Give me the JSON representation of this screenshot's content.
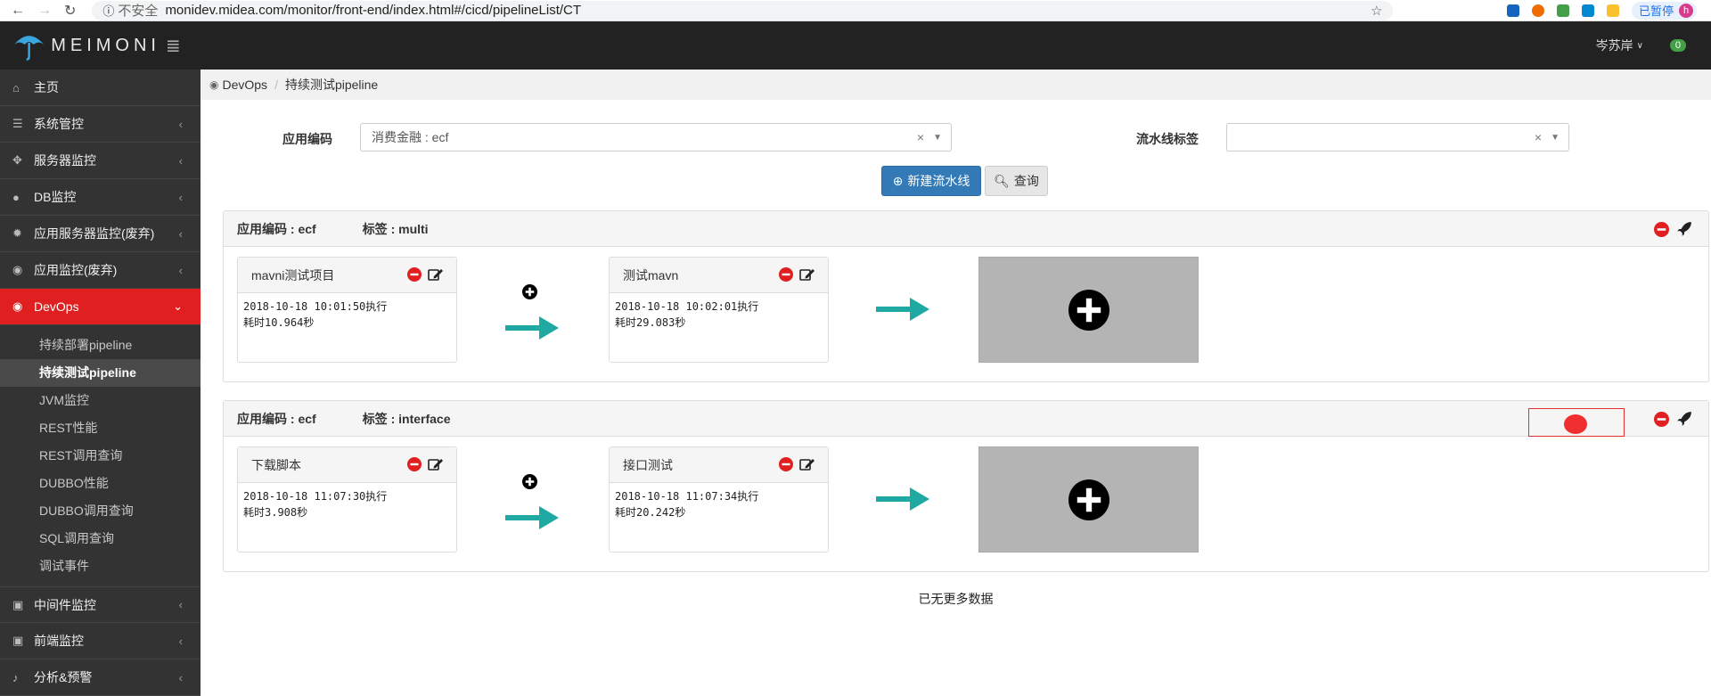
{
  "browser": {
    "security": "不安全",
    "url": "monidev.midea.com/monitor/front-end/index.html#/cicd/pipelineList/CT",
    "profile_label": "已暂停",
    "profile_initial": "h"
  },
  "header": {
    "logo_text": "MEIMONI",
    "user_name": "岑苏岸",
    "message_count": "0"
  },
  "sidebar": {
    "items": [
      {
        "label": "主页",
        "icon": "home-icon"
      },
      {
        "label": "系统管控",
        "icon": "server-stack-icon"
      },
      {
        "label": "服务器监控",
        "icon": "crosshair-icon"
      },
      {
        "label": "DB监控",
        "icon": "globe-icon"
      },
      {
        "label": "应用服务器监控(废弃)",
        "icon": "gear-icon"
      },
      {
        "label": "应用监控(废弃)",
        "icon": "eye-icon"
      },
      {
        "label": "DevOps",
        "icon": "eye-icon"
      }
    ],
    "devops_sub": [
      "持续部署pipeline",
      "持续测试pipeline",
      "JVM监控",
      "REST性能",
      "REST调用查询",
      "DUBBO性能",
      "DUBBO调用查询",
      "SQL调用查询",
      "调试事件"
    ],
    "bottom_items": [
      {
        "label": "中间件监控",
        "icon": "briefcase-icon"
      },
      {
        "label": "前端监控",
        "icon": "briefcase-icon"
      },
      {
        "label": "分析&预警",
        "icon": "bell-icon"
      }
    ]
  },
  "breadcrumb": {
    "root": "DevOps",
    "current": "持续测试pipeline"
  },
  "filter": {
    "app_code_label": "应用编码",
    "app_code_value": "消费金融 : ecf",
    "tag_label": "流水线标签",
    "tag_value": "",
    "new_button": "新建流水线",
    "query_button": "查询"
  },
  "pipelines": [
    {
      "app_code": "应用编码 : ecf",
      "tag": "标签 : multi",
      "stages": [
        {
          "name": "mavni测试项目",
          "time": "2018-10-18 10:01:50执行",
          "duration": "耗时10.964秒"
        },
        {
          "name": "测试mavn",
          "time": "2018-10-18 10:02:01执行",
          "duration": "耗时29.083秒"
        }
      ]
    },
    {
      "app_code": "应用编码 : ecf",
      "tag": "标签 : interface",
      "stages": [
        {
          "name": "下载脚本",
          "time": "2018-10-18 11:07:30执行",
          "duration": "耗时3.908秒"
        },
        {
          "name": "接口测试",
          "time": "2018-10-18 11:07:34执行",
          "duration": "耗时20.242秒"
        }
      ]
    }
  ],
  "footer_text": "已无更多数据",
  "colors": {
    "accent_red": "#e02020",
    "primary_blue": "#337ab7",
    "arrow_teal": "#20a9a3",
    "sidebar_bg": "#333333"
  }
}
